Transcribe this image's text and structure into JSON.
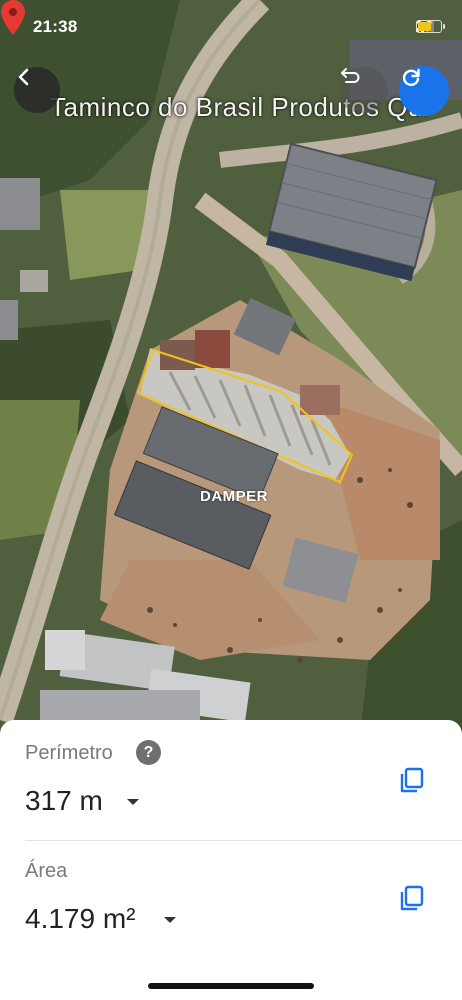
{
  "status_bar": {
    "time": "21:38"
  },
  "map": {
    "place_label": "Taminco do Brasil Produtos Quí",
    "watermark": "DAMPER"
  },
  "measurements": {
    "perimeter": {
      "label": "Perímetro",
      "value": "317 m",
      "help": "?"
    },
    "area": {
      "label": "Área",
      "value": "4.179 m²"
    }
  },
  "colors": {
    "accent": "#1a73e8",
    "pin": "#e53935",
    "outline": "#f2c318"
  },
  "icons": [
    "back-arrow-icon",
    "undo-icon",
    "refresh-icon",
    "location-pin-icon",
    "help-icon",
    "copy-icon",
    "dropdown-arrow-icon",
    "wifi-icon",
    "signal-icon",
    "battery-icon"
  ]
}
